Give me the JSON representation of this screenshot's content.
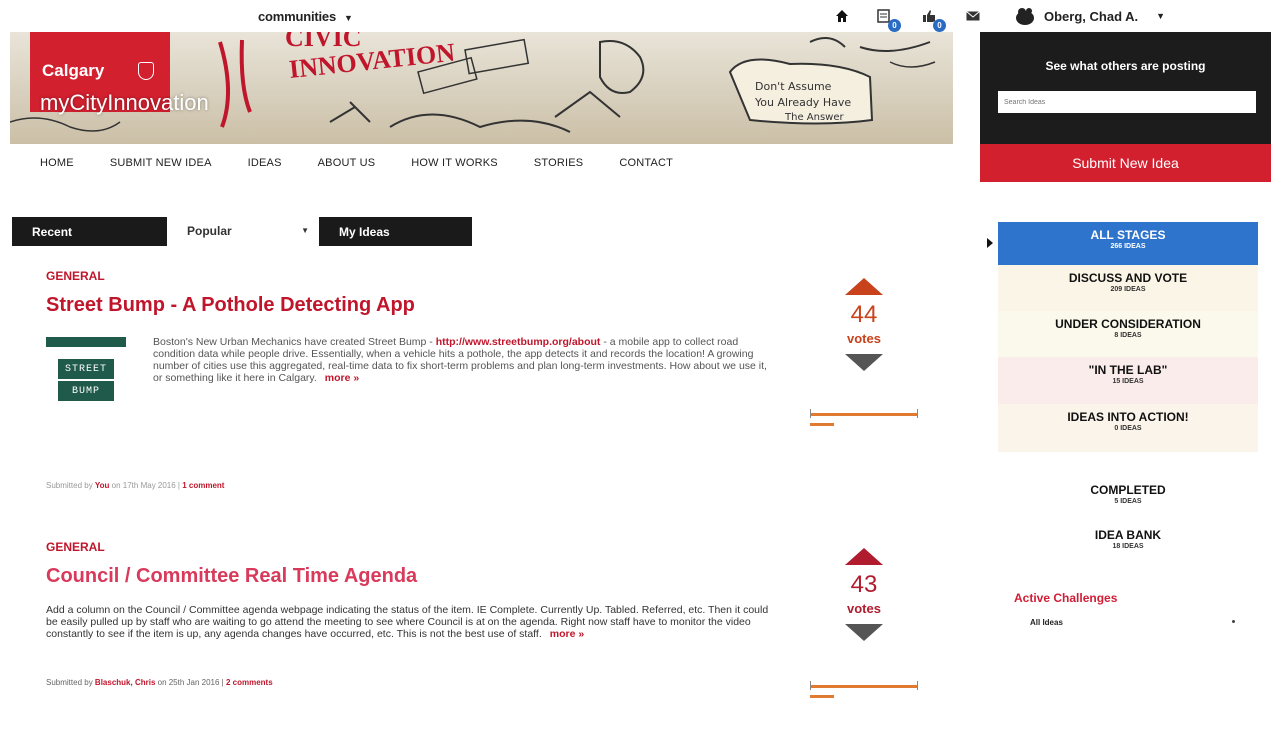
{
  "topbar": {
    "communities_label": "communities",
    "user_name": "Oberg, Chad A."
  },
  "banner": {
    "city_name": "Calgary",
    "site_name": "myCityInnovation"
  },
  "sidebar": {
    "see_what": "See what others are posting",
    "search_placeholder": "Search Ideas",
    "submit_label": "Submit New Idea"
  },
  "nav": {
    "items": [
      "HOME",
      "SUBMIT NEW IDEA",
      "IDEAS",
      "ABOUT US",
      "HOW IT WORKS",
      "STORIES",
      "CONTACT"
    ]
  },
  "sort": {
    "recent": "Recent",
    "popular": "Popular",
    "my_ideas": "My Ideas"
  },
  "ideas": [
    {
      "category": "GENERAL",
      "title": "Street Bump - A Pothole Detecting App",
      "body_pre": "Boston's New Urban Mechanics have created Street Bump - ",
      "body_link": "http://www.streetbump.org/about",
      "body_post": " - a mobile app to collect road condition data while people drive. Essentially, when a vehicle hits a pothole, the app detects it and records the location! A growing number of cities use this aggregated, real-time data to fix short-term problems and plan long-term investments. How about we use it, or something like it here in Calgary.",
      "more": "more »",
      "submitted_prefix": "Submitted by ",
      "author": "You",
      "date_text": " on 17th May 2016 | ",
      "comments": "1 comment",
      "votes": "44",
      "votes_label": "votes",
      "thumb_line1": "STREET",
      "thumb_line2": "BUMP"
    },
    {
      "category": "GENERAL",
      "title": "Council / Committee Real Time Agenda",
      "body": "Add a column on the Council / Committee agenda webpage indicating the status of the item. IE Complete. Currently Up. Tabled. Referred, etc. Then it could be easily pulled up by staff who are waiting to go attend the meeting to see where Council is at on the agenda. Right now staff have to monitor the video constantly to see if the item is up, any agenda changes have occurred, etc. This is not the best use of staff.",
      "more": "more »",
      "submitted_prefix": "Submitted by ",
      "author": "Blaschuk, Chris",
      "date_text": " on 25th Jan 2016 | ",
      "comments": "2 comments",
      "votes": "43",
      "votes_label": "votes"
    }
  ],
  "stages": [
    {
      "name": "ALL STAGES",
      "count": "266 IDEAS"
    },
    {
      "name": "DISCUSS AND VOTE",
      "count": "209 IDEAS"
    },
    {
      "name": "UNDER CONSIDERATION",
      "count": "8 IDEAS"
    },
    {
      "name": "\"IN THE LAB\"",
      "count": "15 IDEAS"
    },
    {
      "name": "IDEAS INTO ACTION!",
      "count": "0 IDEAS"
    },
    {
      "name": "COMPLETED",
      "count": "5 IDEAS"
    },
    {
      "name": "IDEA BANK",
      "count": "18 IDEAS"
    }
  ],
  "challenges": {
    "title": "Active Challenges",
    "item": "All Ideas"
  },
  "colors": {
    "brand_red": "#d2202f",
    "active_stage": "#2f74cc",
    "vote_orange": "#c8421b"
  }
}
